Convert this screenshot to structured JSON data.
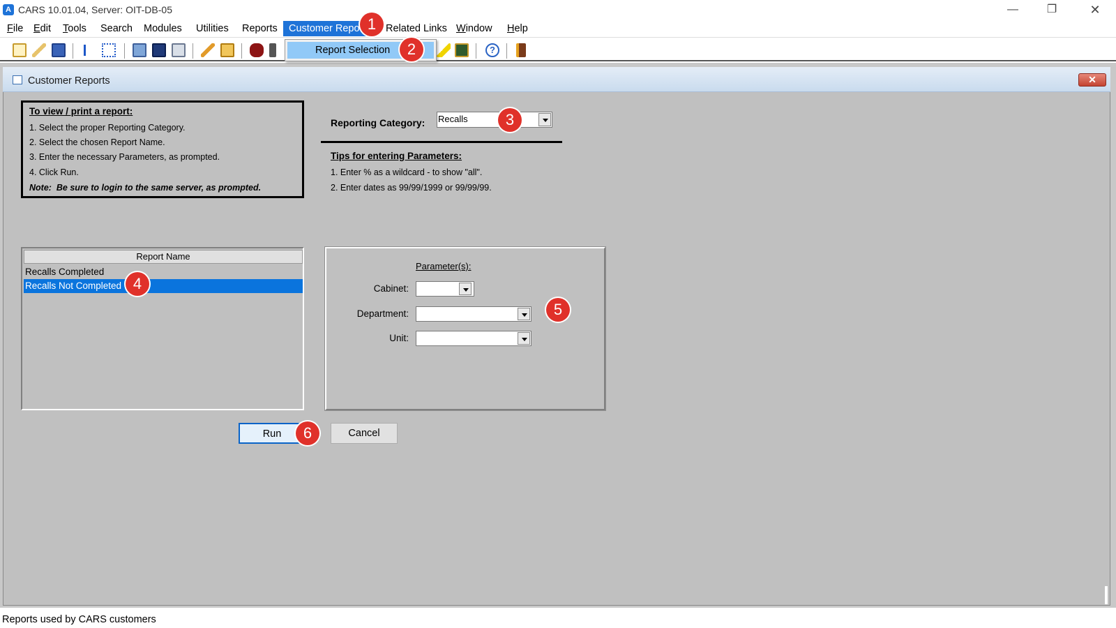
{
  "window": {
    "app_icon": "app-icon",
    "title": "CARS 10.01.04, Server: OIT-DB-05",
    "controls": [
      "minimize",
      "maximize",
      "close"
    ]
  },
  "menubar": {
    "items": [
      {
        "label": "File",
        "mnemonic": "F",
        "rest": "ile"
      },
      {
        "label": "Edit",
        "mnemonic": "E",
        "rest": "dit"
      },
      {
        "label": "Tools",
        "mnemonic": "T",
        "rest": "ools"
      },
      {
        "label": "Search"
      },
      {
        "label": "Modules"
      },
      {
        "label": "Utilities"
      },
      {
        "label": "Reports"
      },
      {
        "label": "Customer Repo"
      },
      {
        "label": "Related Links"
      },
      {
        "label": "Window",
        "mnemonic": "W",
        "rest": "indow"
      },
      {
        "label": "Help",
        "mnemonic": "H",
        "rest": "elp"
      }
    ],
    "active_index": 7
  },
  "dropdown": {
    "items": [
      "Report Selection"
    ]
  },
  "child_window": {
    "title": "Customer Reports",
    "close_label": "✕"
  },
  "instructions": {
    "heading": "To view / print a report:",
    "steps": [
      "1.  Select the proper Reporting Category.",
      "2.  Select the chosen Report Name.",
      "3.  Enter the necessary Parameters, as prompted.",
      "4.  Click Run."
    ],
    "note_prefix": "Note:",
    "note_text": "Be sure to login to the same server, as prompted."
  },
  "reporting_category": {
    "label": "Reporting Category:",
    "value": "Recalls"
  },
  "tips": {
    "heading": "Tips for entering Parameters:",
    "items": [
      "1.  Enter % as a wildcard - to show \"all\".",
      "2.  Enter dates as  99/99/1999  or  99/99/99."
    ]
  },
  "report_list": {
    "header": "Report Name",
    "rows": [
      "Recalls Completed",
      "Recalls Not Completed"
    ],
    "selected_index": 1
  },
  "parameters": {
    "title": "Parameter(s):",
    "fields": [
      {
        "label": "Cabinet:",
        "value": ""
      },
      {
        "label": "Department:",
        "value": ""
      },
      {
        "label": "Unit:",
        "value": ""
      }
    ]
  },
  "buttons": {
    "run": "Run",
    "cancel": "Cancel"
  },
  "status_bar": {
    "text": "Reports used by CARS customers"
  },
  "markers": [
    "1",
    "2",
    "3",
    "4",
    "5",
    "6"
  ],
  "colors": {
    "accent": "#1e73d8",
    "selection": "#0a74dd",
    "marker": "#e0312a",
    "dialog_bg": "#c0c0c0"
  }
}
